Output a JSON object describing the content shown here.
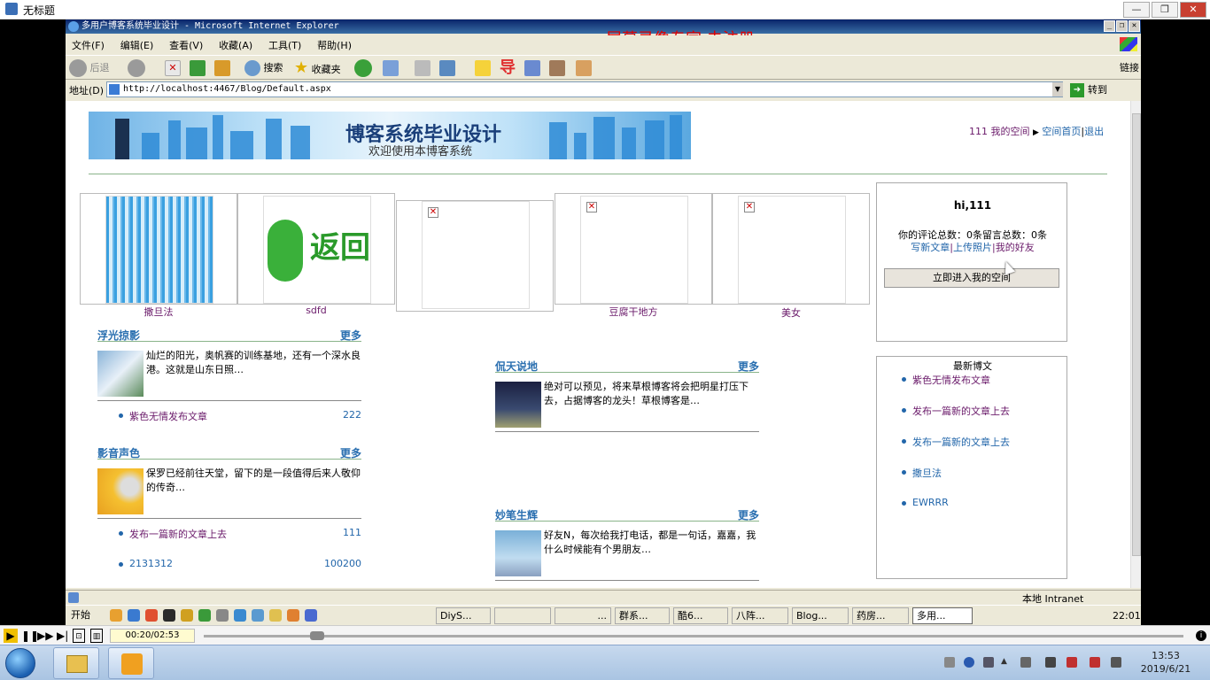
{
  "outer_window": {
    "title": "无标题"
  },
  "ie": {
    "title": "多用户博客系统毕业设计 - Microsoft Internet Explorer",
    "recorder_watermark": "屏幕录像专家  未注册",
    "menu": [
      "文件(F)",
      "编辑(E)",
      "查看(V)",
      "收藏(A)",
      "工具(T)",
      "帮助(H)"
    ],
    "toolbar": {
      "back": "后退",
      "search": "搜索",
      "favorites": "收藏夹",
      "dao": "导"
    },
    "address_label": "地址(D)",
    "address": "http://localhost:4467/Blog/Default.aspx",
    "go": "转到",
    "links": "链接",
    "status_zone": "本地 Intranet"
  },
  "page": {
    "banner_title": "博客系统毕业设计",
    "banner_sub": "欢迎使用本博客系统",
    "top_links": {
      "space": "111 我的空间",
      "home": "空间首页",
      "logout": "退出"
    },
    "photos": [
      {
        "caption": "撒旦法"
      },
      {
        "caption": "sdfd"
      },
      {
        "caption": ""
      },
      {
        "caption": "豆腐干地方"
      },
      {
        "caption": "美女"
      }
    ],
    "user": {
      "hi": "hi,111",
      "stats": "你的评论总数：0条留言总数：0条",
      "links": [
        "写新文章",
        "上传照片",
        "我的好友"
      ],
      "enter": "立即进入我的空间"
    },
    "news": {
      "title": "最新博文",
      "items": [
        "紫色无情发布文章",
        "发布一篇新的文章上去",
        "发布一篇新的文章上去",
        "撒旦法",
        "EWRRR"
      ]
    },
    "sections": [
      {
        "name": "浮光掠影",
        "more": "更多",
        "text": "灿烂的阳光，奥帆赛的训练基地，还有一个深水良港。这就是山东日照…",
        "items": [
          {
            "title": "紫色无情发布文章",
            "count": "222"
          }
        ]
      },
      {
        "name": "影音声色",
        "more": "更多",
        "text": "保罗已经前往天堂，留下的是一段值得后来人敬仰的传奇…",
        "items": [
          {
            "title": "发布一篇新的文章上去",
            "count": "111"
          },
          {
            "title": "2131312",
            "count": "100200"
          }
        ]
      },
      {
        "name": "侃天说地",
        "more": "更多",
        "text": "绝对可以预见，将来草根博客将会把明星打压下去，占据博客的龙头！草根博客是…",
        "items": []
      },
      {
        "name": "妙笔生辉",
        "more": "更多",
        "text": "好友N，每次给我打电话，都是一句话，嘉嘉，我什么时候能有个男朋友…",
        "items": []
      }
    ]
  },
  "xp_taskbar": {
    "start": "开始",
    "tasks": [
      "DiyS...",
      "",
      "...",
      "群系...",
      "酷6...",
      "八阵...",
      "Blog...",
      "药房...",
      "多用..."
    ],
    "clock": "22:01"
  },
  "player": {
    "time": "00:20/02:53",
    "progress": 0.116
  },
  "win7": {
    "time": "13:53",
    "date": "2019/6/21"
  },
  "colors": {
    "link_purple": "#6a1a6a",
    "link_blue": "#2266aa",
    "xp_title": "#0a246a",
    "watermark": "#e00000"
  }
}
